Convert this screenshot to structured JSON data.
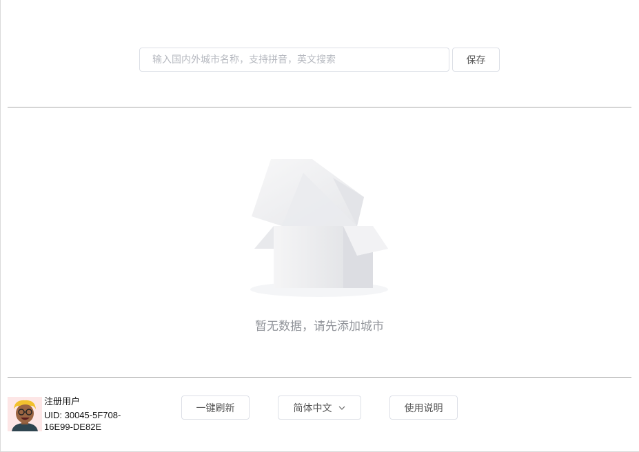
{
  "search": {
    "placeholder": "输入国内外城市名称，支持拼音，英文搜索",
    "value": ""
  },
  "toolbar": {
    "save_label": "保存"
  },
  "empty_state": {
    "message": "暂无数据，请先添加城市",
    "icon": "empty-box-icon"
  },
  "footer": {
    "user_type": "注册用户",
    "uid": "UID: 30045-5F708-16E99-DE82E",
    "refresh_label": "一键刷新",
    "language_label": "简体中文",
    "help_label": "使用说明"
  },
  "colors": {
    "border": "#dcdfe6",
    "divider": "#a8a8a8",
    "muted_text": "#909399"
  }
}
